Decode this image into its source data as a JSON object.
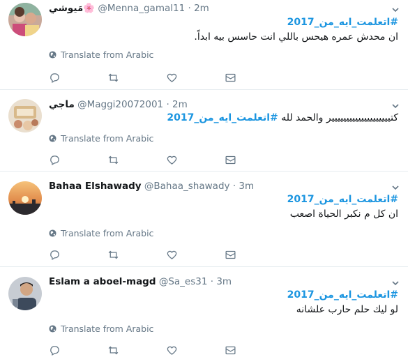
{
  "translate_label": "Translate from Arabic",
  "colors": {
    "link": "#1b95e0",
    "muted": "#657786",
    "text": "#14171a",
    "divider": "#e6ecf0"
  },
  "icons": {
    "reply": "reply-icon",
    "retweet": "retweet-icon",
    "like": "heart-icon",
    "dm": "envelope-icon",
    "translate": "globe-icon",
    "menu": "chevron-down-icon"
  },
  "tweets": [
    {
      "name": "مَيوشي🌸",
      "handle": "@Menna_gamal11",
      "sep": "·",
      "time": "2m",
      "hashtag": "#اتعلمت_ايه_من_2017",
      "text": "ان محدش عمره هيحس باللي انت حاسس بيه ابداً."
    },
    {
      "name": "ماجي",
      "handle": "@Maggi20072001",
      "sep": "·",
      "time": "2m",
      "hashtag": "#اتعلمت_ايه_من_2017",
      "text": "كتيييييييييييييييييييير والحمد لله"
    },
    {
      "name": "Bahaa Elshawady",
      "handle": "@Bahaa_shawady",
      "sep": "·",
      "time": "3m",
      "hashtag": "#اتعلمت_ايه_من_2017",
      "text": "ان كل م نكبر الحياة اصعب"
    },
    {
      "name": "Eslam a aboel-magd",
      "handle": "@Sa_es31",
      "sep": "·",
      "time": "3m",
      "hashtag": "#اتعلمت_ايه_من_2017",
      "text": "لو ليك حلم  حارب علشانه"
    }
  ]
}
